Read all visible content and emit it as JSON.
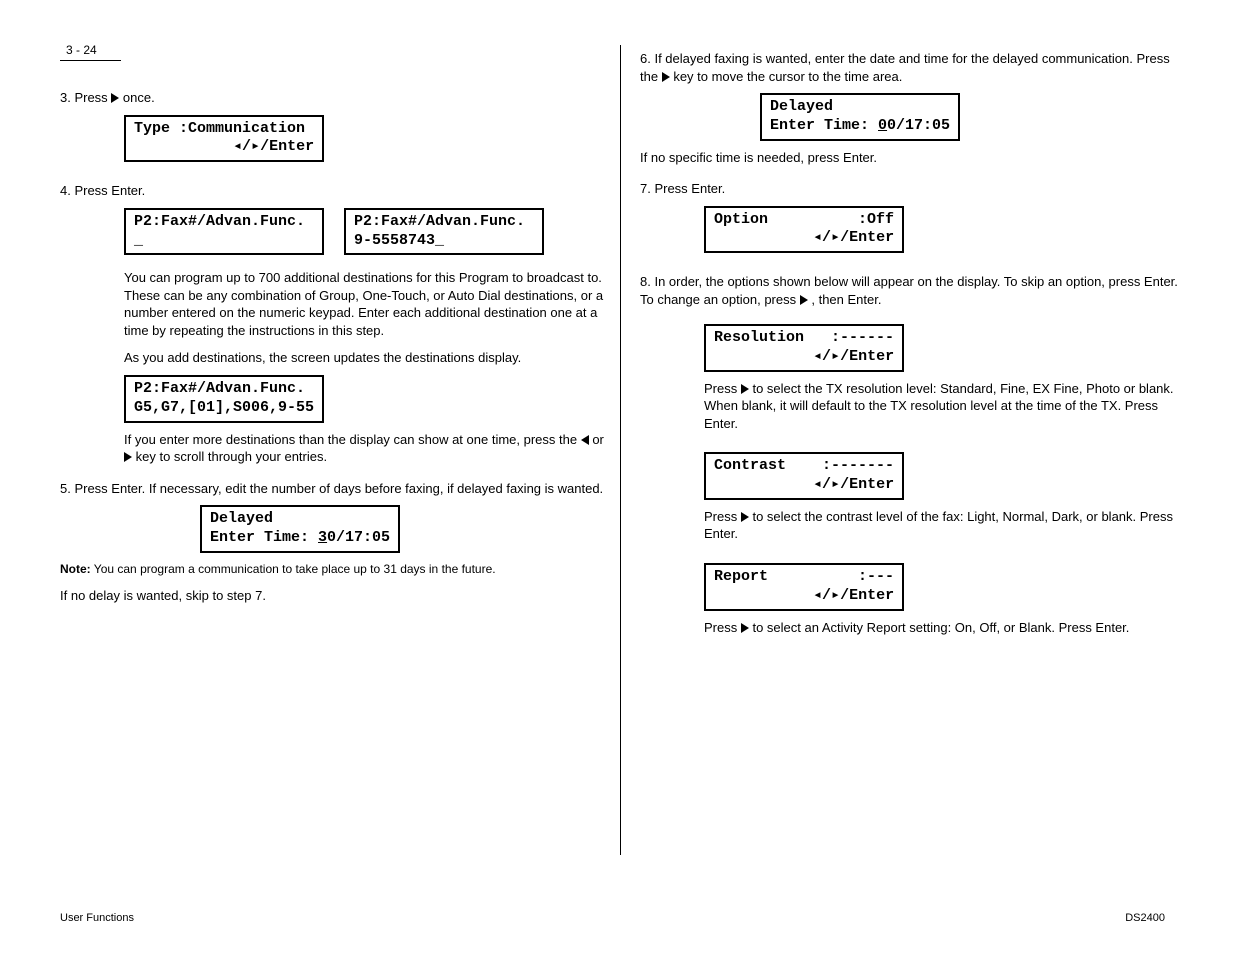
{
  "page_label": "3 - 24",
  "left": {
    "step3": {
      "text": "3.  Press ",
      "text2": " once.",
      "lcd_line1": "Type :Communication",
      "lcd_line2": "           ◂/▸/Enter"
    },
    "step4": {
      "text_a": "4.  Press Enter.",
      "lcd_a_line1": "P2:Fax#/Advan.Func.",
      "lcd_a_line2": "_",
      "lcd_b_line1": "P2:Fax#/Advan.Func.",
      "lcd_b_line2": "9-5558743_",
      "para1": "You can program up to 700 additional destinations for this Program to broadcast to.  These can be any combination of Group, One-Touch, or Auto Dial destinations, or a number entered on the numeric keypad.  Enter each additional destination one at a time by repeating the instructions in this step.",
      "para2": "As you add destinations, the screen updates the destinations display.",
      "lcd_c_line1": "P2:Fax#/Advan.Func.",
      "lcd_c_line2": "G5,G7,[01],S006,9-55",
      "para3_a": "If you enter more destinations than the display can show at one time, press the ",
      "para3_b": " or ",
      "para3_c": " key to scroll through your entries."
    },
    "step5": {
      "text_a": "5.  Press Enter.  If necessary, edit the number of days before faxing, if delayed faxing is wanted.",
      "lcd_line1": "Delayed",
      "lcd_line2_a": "Enter Time: ",
      "lcd_line2_b": "3",
      "lcd_line2_c": "0/17:05",
      "note_a": "Note:",
      "note_b": "You can program a communication to take place up to 31 days in the future.",
      "text_b": "If no delay is wanted, skip to step 7."
    },
    "footer": "User Functions"
  },
  "right": {
    "step6": {
      "text_a": "6.  If delayed faxing is wanted, enter the date and time for the delayed communication.  Press the ",
      "text_b": " key to move the cursor to the time area.",
      "lcd_line1": "Delayed",
      "lcd_line2_a": "Enter Time: ",
      "lcd_line2_b": "0",
      "lcd_line2_c": "0/17:05",
      "para": "If no specific time is needed, press Enter."
    },
    "step7": {
      "text": "7.  Press Enter.",
      "lcd_line1": "Option          :Off",
      "lcd_line2": "           ◂/▸/Enter"
    },
    "step8": {
      "text_a": "8.  In order, the options shown below will appear on the display.  To skip an option, press Enter.  To change an option, press ",
      "text_b": ", then Enter.",
      "resolution": {
        "lcd_line1": "Resolution   :------",
        "lcd_line2": "           ◂/▸/Enter",
        "text_a": "Press ",
        "text_b": " to select the TX resolution level:  Standard, Fine, EX Fine, Photo or blank.  When blank, it will default to the TX resolution level at the time of the TX.  Press Enter."
      },
      "contrast": {
        "lcd_line1": "Contrast    :-------",
        "lcd_line2": "           ◂/▸/Enter",
        "text_a": "Press ",
        "text_b": " to select the contrast level of the fax:  Light, Normal, Dark, or blank.  Press Enter."
      },
      "report": {
        "lcd_line1": "Report          :---",
        "lcd_line2": "           ◂/▸/Enter",
        "text_a": "Press ",
        "text_b": " to select an Activity Report setting:  On, Off, or Blank.  Press Enter."
      }
    },
    "footer": "DS2400"
  }
}
